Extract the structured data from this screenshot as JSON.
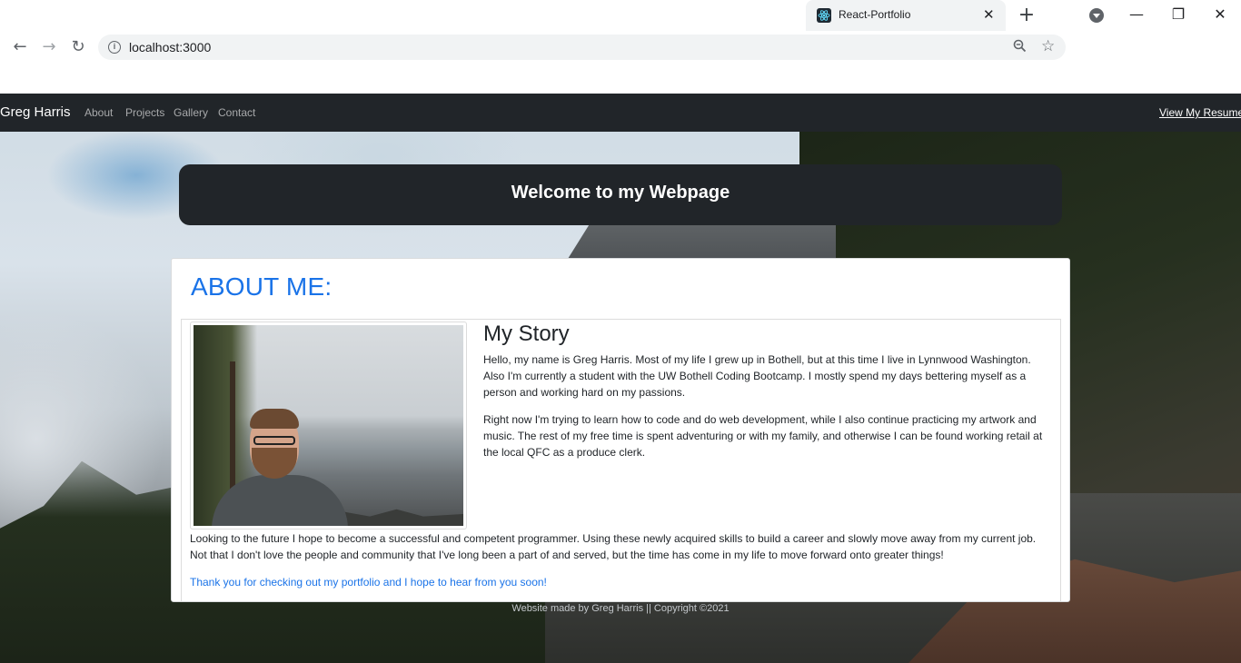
{
  "browser": {
    "tab_title": "React-Portfolio",
    "tab_close": "✕",
    "new_tab": "+",
    "url": "localhost:3000",
    "back": "←",
    "forward": "→",
    "reload": "↻",
    "zoom_icon": "magnifier-minus",
    "star_icon": "star",
    "window": {
      "minimize": "—",
      "maximize": "❐",
      "close": "✕"
    }
  },
  "navbar": {
    "brand": "Greg Harris",
    "links": [
      "About",
      "Projects",
      "Gallery",
      "Contact"
    ],
    "resume": "View My Resume"
  },
  "welcome": {
    "title": "Welcome to my Webpage"
  },
  "about": {
    "heading": "ABOUT ME:",
    "story_title": "My Story",
    "paragraphs": [
      "Hello, my name is Greg Harris. Most of my life I grew up in Bothell, but at this time I live in Lynnwood Washington. Also I'm currently a student with the UW Bothell Coding Bootcamp. I mostly spend my days bettering myself as a person and working hard on my passions.",
      "Right now I'm trying to learn how to code and do web development, while I also continue practicing my artwork and music. The rest of my free time is spent adventuring or with my family, and otherwise I can be found working retail at the local QFC as a produce clerk.",
      "Looking to the future I hope to become a successful and competent programmer. Using these newly acquired skills to build a career and slowly move away from my current job. Not that I don't love the people and community that I've long been a part of and served, but the time has come in my life to move forward onto greater things!",
      "Thank you for checking out my portfolio and I hope to hear from you soon!"
    ]
  },
  "footer": {
    "text": "Website made by Greg Harris || Copyright ©2021"
  },
  "colors": {
    "navbar": "#212529",
    "accent": "#1a73e8"
  }
}
